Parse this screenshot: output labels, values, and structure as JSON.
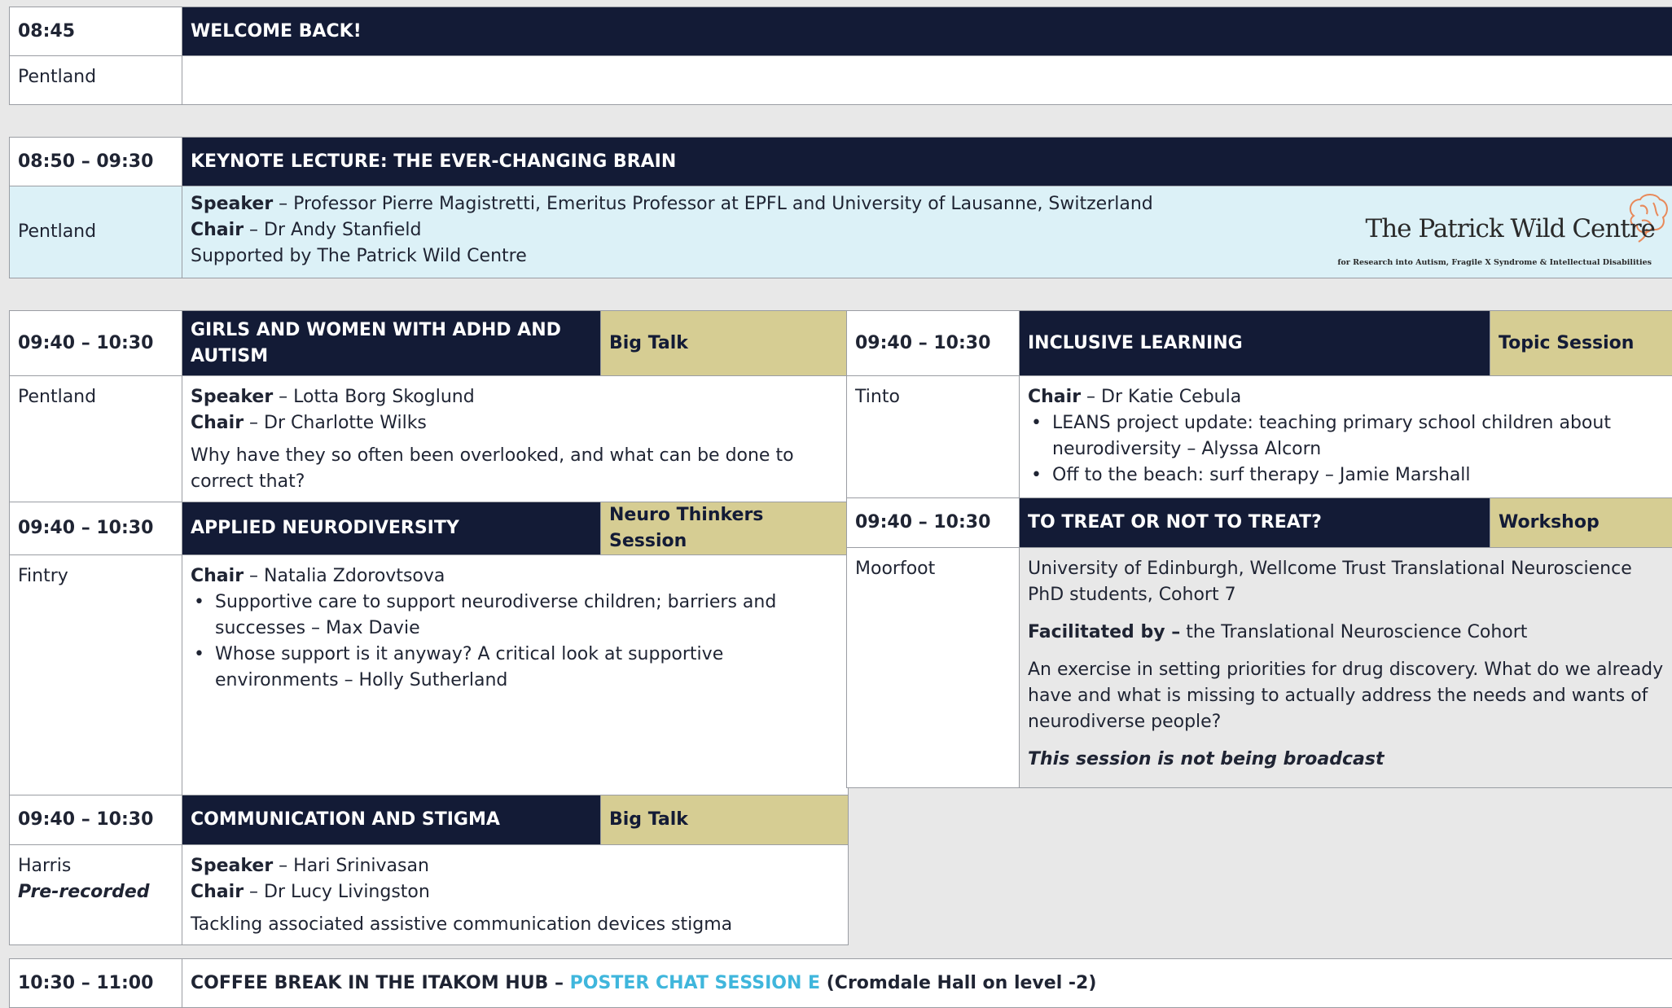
{
  "welcome": {
    "time": "08:45",
    "title": "WELCOME BACK!",
    "room": "Pentland"
  },
  "keynote": {
    "time": "08:50 – 09:30",
    "title": "KEYNOTE LECTURE: THE EVER-CHANGING BRAIN",
    "room": "Pentland",
    "speaker_label": "Speaker",
    "speaker": " – Professor Pierre Magistretti, Emeritus Professor at EPFL and University of Lausanne, Switzerland",
    "chair_label": "Chair",
    "chair": " – Dr Andy Stanfield",
    "support": "Supported by The Patrick Wild Centre",
    "logo_title": "The Patrick Wild Centre",
    "logo_sub": "for Research into Autism, Fragile X Syndrome & Intellectual Disabilities"
  },
  "girls": {
    "time": "09:40 – 10:30",
    "title": "GIRLS AND WOMEN WITH ADHD AND AUTISM",
    "tag": "Big Talk",
    "room": "Pentland",
    "speaker_label": "Speaker",
    "speaker": " – Lotta Borg Skoglund",
    "chair_label": "Chair",
    "chair": " – Dr Charlotte Wilks",
    "desc": "Why have they so often been overlooked, and what can be done to correct that?"
  },
  "inclusive": {
    "time": "09:40 – 10:30",
    "title": "INCLUSIVE LEARNING",
    "tag": "Topic Session",
    "room": "Tinto",
    "chair_label": "Chair",
    "chair": " – Dr Katie Cebula",
    "items": [
      "LEANS project update: teaching primary school children about neurodiversity – Alyssa Alcorn",
      "Off to the beach: surf therapy – Jamie Marshall"
    ]
  },
  "applied": {
    "time": "09:40 – 10:30",
    "title": "APPLIED NEURODIVERSITY",
    "tag": "Neuro Thinkers Session",
    "room": "Fintry",
    "chair_label": "Chair",
    "chair": " – Natalia Zdorovtsova",
    "items": [
      "Supportive care to support neurodiverse children; barriers and successes – Max Davie",
      "Whose support is it anyway? A critical look at supportive environments – Holly Sutherland"
    ]
  },
  "treat": {
    "time": "09:40 – 10:30",
    "title": "TO TREAT OR NOT TO TREAT?",
    "tag": "Workshop",
    "room": "Moorfoot",
    "intro": "University of Edinburgh, Wellcome Trust Translational Neuroscience PhD students, Cohort 7",
    "facilitated_label": "Facilitated by –",
    "facilitated": " the Translational Neuroscience Cohort",
    "desc": "An exercise in setting priorities for drug discovery. What do we already have and what is missing to actually address the needs and wants of neurodiverse people?",
    "note": "This session is not being broadcast"
  },
  "comm": {
    "time": "09:40 – 10:30",
    "title": "COMMUNICATION AND STIGMA",
    "tag": "Big Talk",
    "room": "Harris",
    "room_note": "Pre-recorded",
    "speaker_label": "Speaker",
    "speaker": " – Hari Srinivasan",
    "chair_label": "Chair",
    "chair": " – Dr Lucy Livingston",
    "desc": "Tackling associated assistive communication devices stigma"
  },
  "coffee": {
    "time": "10:30 – 11:00",
    "title_a": "COFFEE BREAK IN THE ITAKOM HUB – ",
    "title_b": "POSTER CHAT SESSION E",
    "title_c": " (Cromdale Hall on level -2)"
  }
}
